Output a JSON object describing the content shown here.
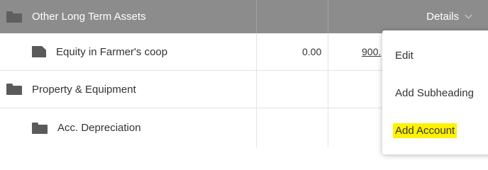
{
  "header": {
    "title": "Other Long Term Assets",
    "details_label": "Details"
  },
  "rows": [
    {
      "label": "Equity in Farmer's coop",
      "value1": "0.00",
      "value2": "900."
    },
    {
      "label": "Property & Equipment"
    },
    {
      "label": "Acc. Depreciation"
    }
  ],
  "menu": {
    "items": [
      {
        "label": "Edit"
      },
      {
        "label": "Add Subheading"
      },
      {
        "label": "Add Account"
      }
    ]
  },
  "colors": {
    "header_bg": "#8c8c8c",
    "highlight": "#fff200",
    "icon": "#5a5a5a"
  }
}
